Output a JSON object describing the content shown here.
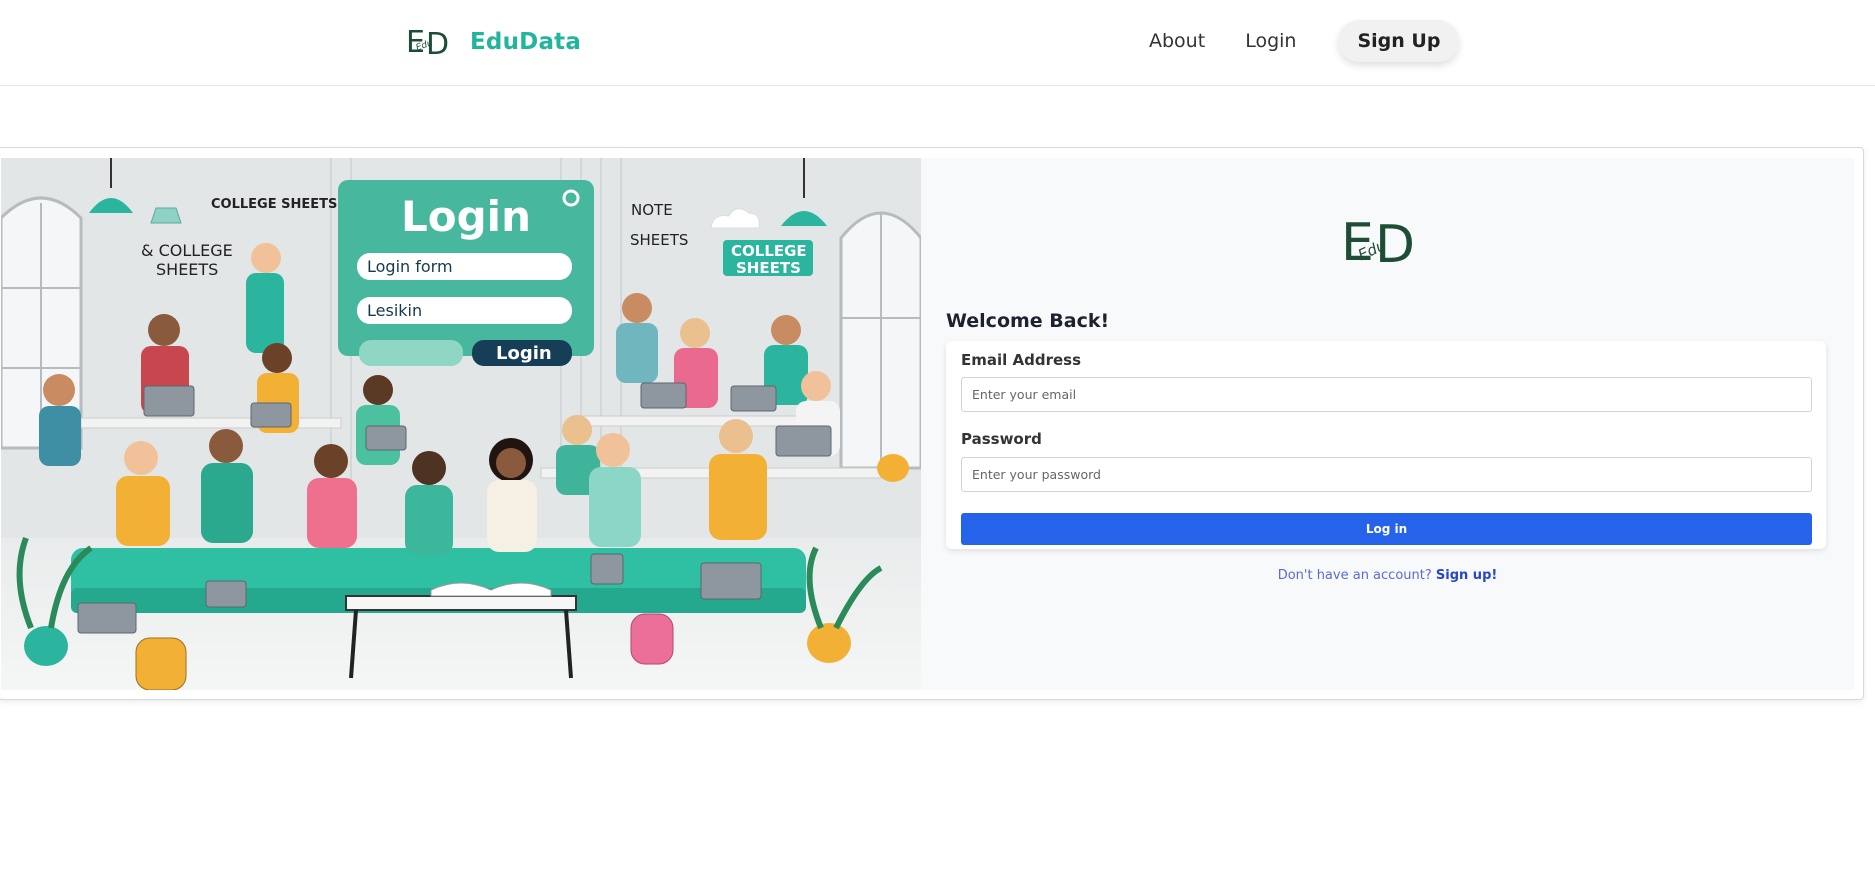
{
  "header": {
    "brand_name": "EduData",
    "nav": {
      "about": "About",
      "login": "Login",
      "signup": "Sign Up"
    }
  },
  "hero": {
    "alt": "Illustration of students studying with laptops and a login form",
    "texts": {
      "college_sheets_top": "COLLEGE SHEETS",
      "college_sheets_left_1": "& COLLEGE",
      "college_sheets_left_2": "SHEETS",
      "login_title": "Login",
      "login_form": "Login form",
      "login_field": "Lesikin",
      "login_button": "Login",
      "note_1": "NOTE",
      "note_2": "SHEETS",
      "badge_1": "COLLEGE",
      "badge_2": "SHEETS"
    }
  },
  "form": {
    "welcome": "Welcome Back!",
    "email_label": "Email Address",
    "email_placeholder": "Enter your email",
    "password_label": "Password",
    "password_placeholder": "Enter your password",
    "submit_label": "Log in",
    "signup_prompt": "Don't have an account?",
    "signup_link": "Sign up!"
  },
  "colors": {
    "brand": "#23b59c",
    "primary_button": "#2563eb",
    "teal": "#2bb59f"
  }
}
